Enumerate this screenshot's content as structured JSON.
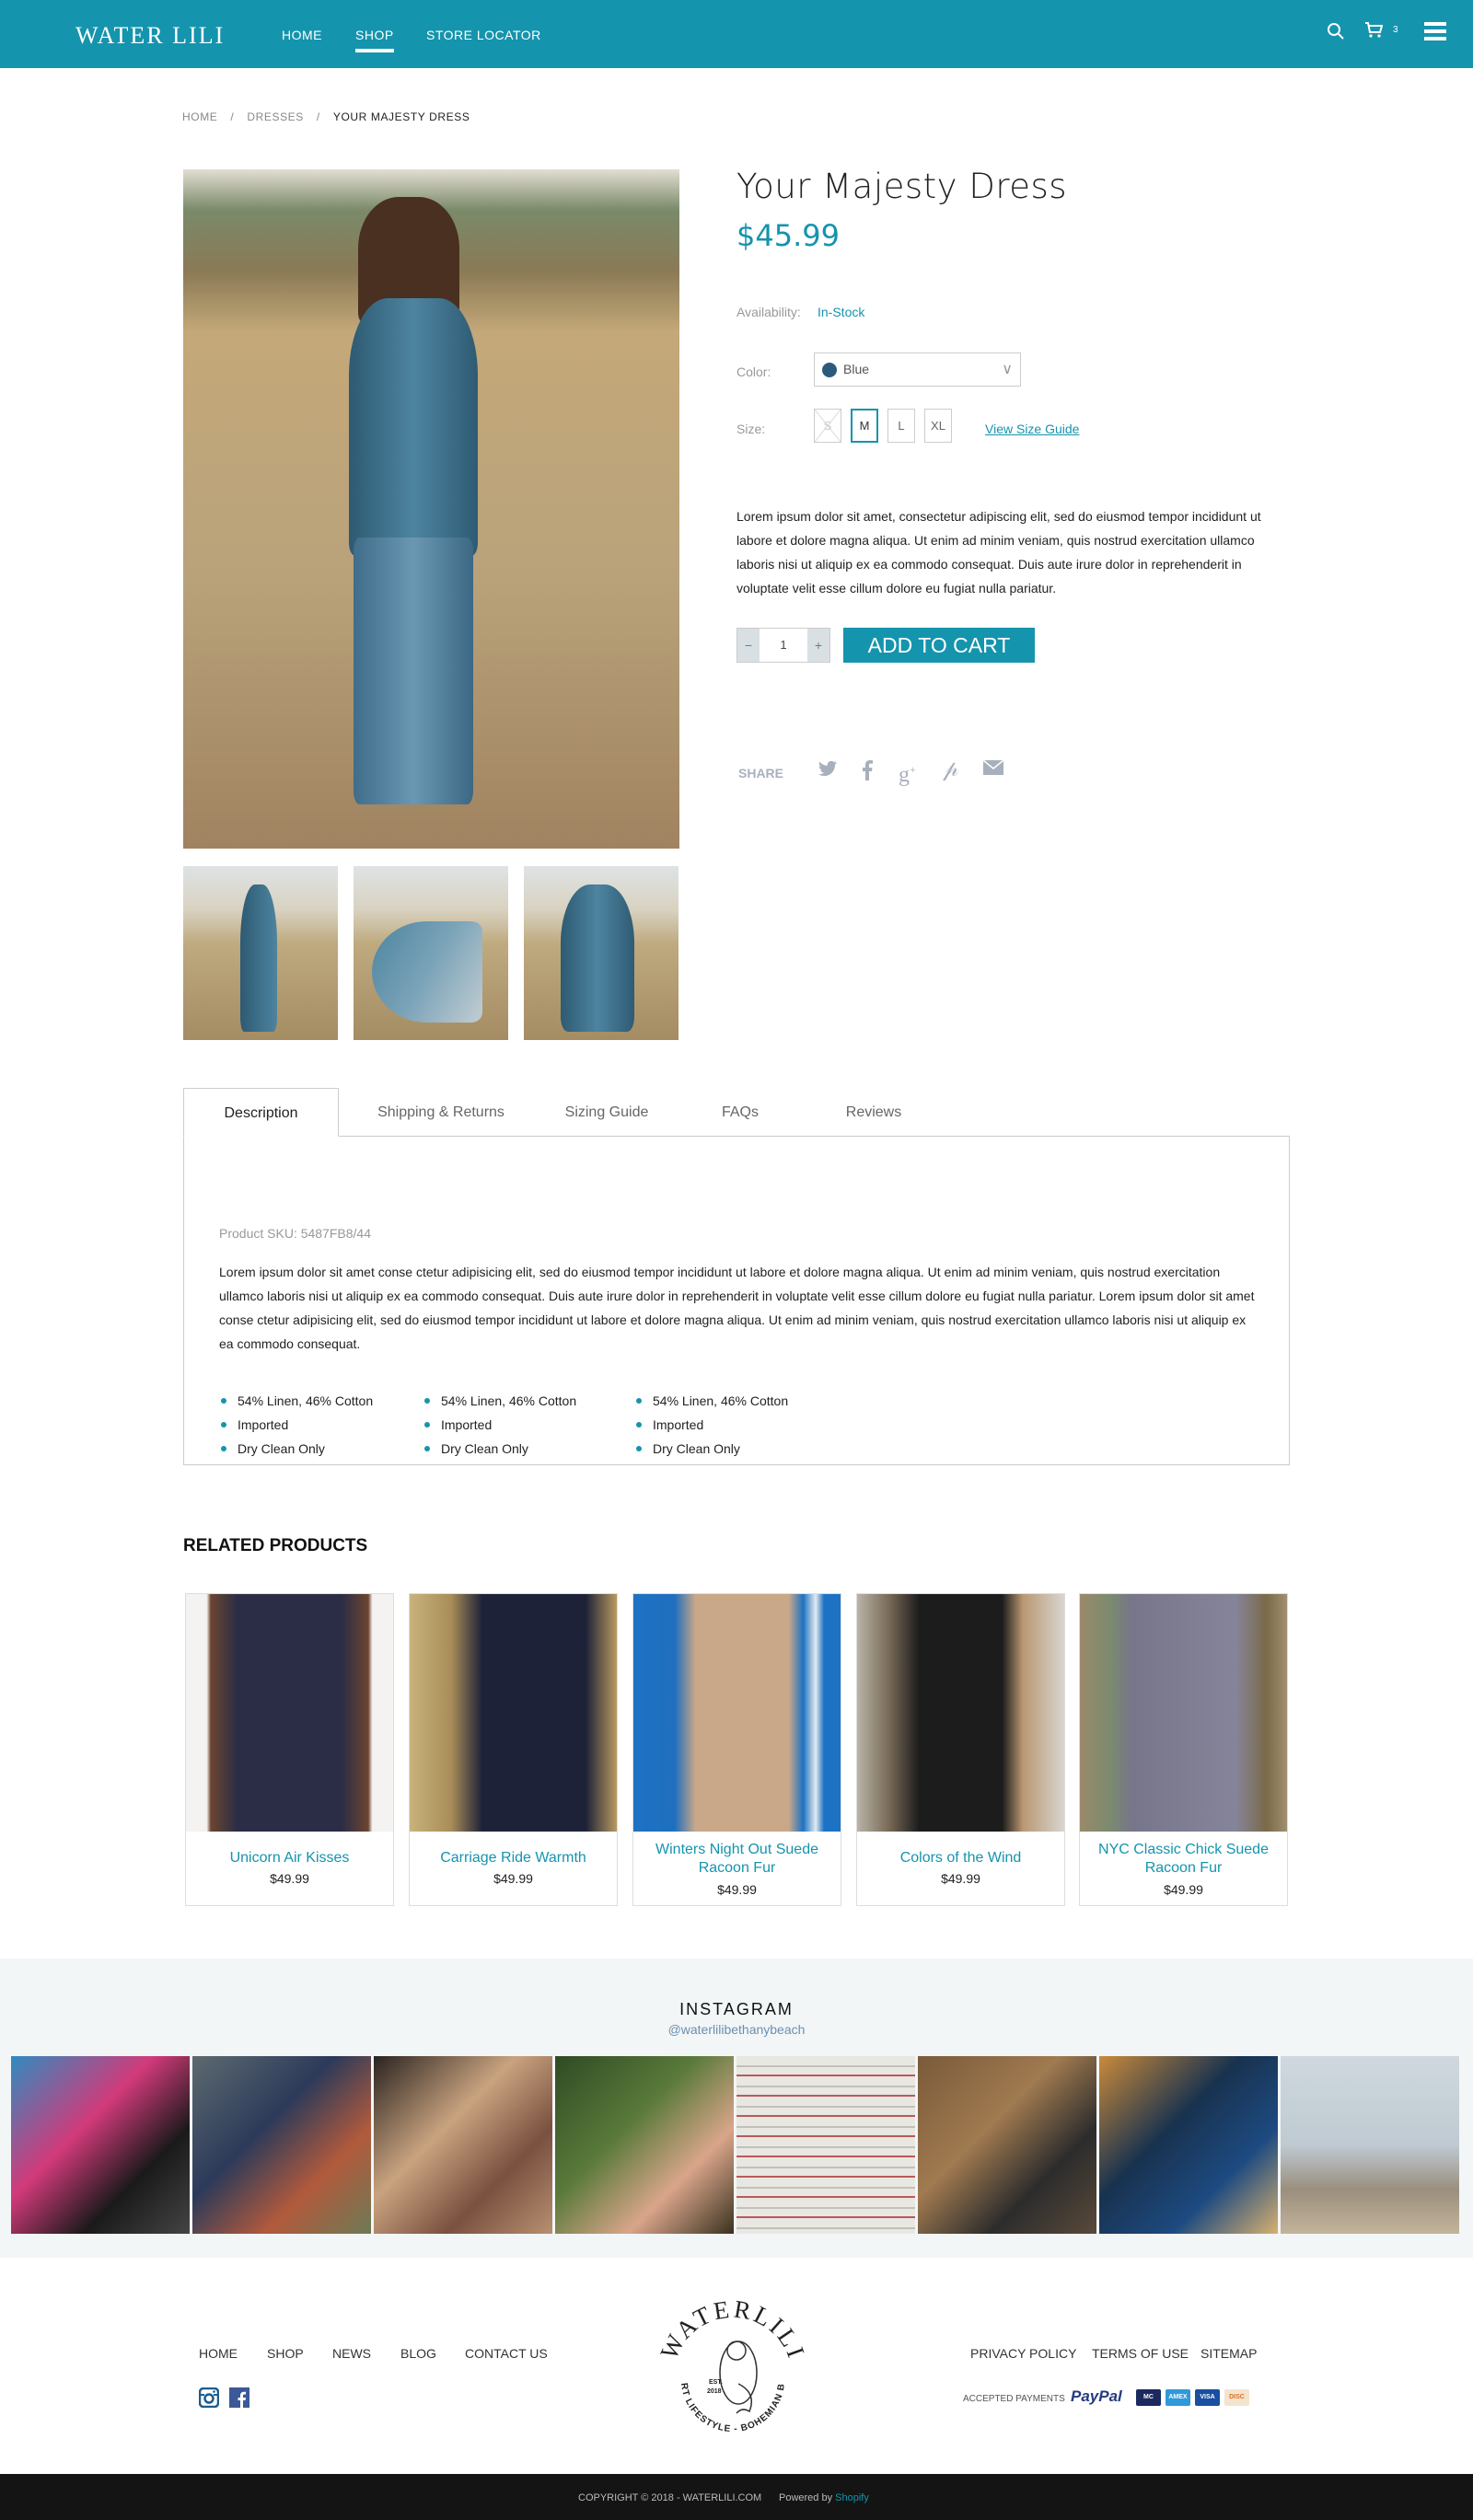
{
  "header": {
    "logo": "WATER LILI",
    "nav": [
      {
        "label": "HOME",
        "active": false
      },
      {
        "label": "SHOP",
        "active": true
      },
      {
        "label": "STORE LOCATOR",
        "active": false
      }
    ],
    "cart_count": "3",
    "icons": [
      "search-icon",
      "cart-icon",
      "menu-icon"
    ]
  },
  "breadcrumb": {
    "items": [
      "HOME",
      "DRESSES",
      "YOUR MAJESTY DRESS"
    ],
    "separator": "/"
  },
  "product": {
    "title": "Your Majesty Dress",
    "price": "$45.99",
    "availability_label": "Availability:",
    "availability_value": "In-Stock",
    "color_label": "Color:",
    "color_value": "Blue",
    "color_swatch": "#2b5b7c",
    "size_label": "Size:",
    "sizes": [
      {
        "label": "S",
        "state": "unavailable"
      },
      {
        "label": "M",
        "state": "selected"
      },
      {
        "label": "L",
        "state": "available"
      },
      {
        "label": "XL",
        "state": "available"
      }
    ],
    "size_guide_link": "View Size Guide",
    "description": "Lorem ipsum dolor sit amet, consectetur adipiscing elit, sed do eiusmod tempor incididunt ut labore et dolore magna aliqua. Ut enim ad minim veniam, quis nostrud exercitation ullamco laboris nisi ut aliquip ex ea commodo consequat. Duis aute irure dolor in reprehenderit in voluptate velit esse cillum dolore eu fugiat nulla pariatur.",
    "quantity": "1",
    "qty_minus": "−",
    "qty_plus": "+",
    "add_to_cart": "ADD TO CART",
    "share_label": "SHARE",
    "share_icons": [
      "twitter-icon",
      "facebook-icon",
      "google-plus-icon",
      "pinterest-icon",
      "email-icon"
    ]
  },
  "tabs": {
    "items": [
      "Description",
      "Shipping & Returns",
      "Sizing Guide",
      "FAQs",
      "Reviews"
    ],
    "active": "Description",
    "sku": "Product SKU: 5487FB8/44",
    "body": "Lorem ipsum dolor sit amet conse ctetur adipisicing elit, sed do eiusmod tempor incididunt ut labore et dolore magna aliqua. Ut enim ad minim veniam, quis nostrud exercitation ullamco laboris nisi ut aliquip ex ea commodo consequat. Duis aute irure dolor in reprehenderit in voluptate velit esse cillum dolore eu fugiat nulla pariatur. Lorem ipsum dolor sit amet conse ctetur adipisicing elit, sed do eiusmod tempor incididunt ut labore et dolore magna aliqua. Ut enim ad minim veniam, quis nostrud exercitation ullamco laboris nisi ut aliquip ex ea commodo consequat.",
    "bullet_columns": [
      [
        "54% Linen, 46% Cotton",
        "Imported",
        "Dry Clean Only"
      ],
      [
        "54% Linen, 46% Cotton",
        "Imported",
        "Dry Clean Only"
      ],
      [
        "54% Linen, 46% Cotton",
        "Imported",
        "Dry Clean Only"
      ]
    ]
  },
  "related": {
    "heading": "RELATED PRODUCTS",
    "products": [
      {
        "name": "Unicorn Air Kisses",
        "price": "$49.99"
      },
      {
        "name": "Carriage Ride Warmth",
        "price": "$49.99"
      },
      {
        "name": "Winters Night Out Suede Racoon Fur",
        "price": "$49.99"
      },
      {
        "name": "Colors of the Wind",
        "price": "$49.99"
      },
      {
        "name": "NYC Classic Chick Suede Racoon Fur",
        "price": "$49.99"
      }
    ]
  },
  "instagram": {
    "heading": "INSTAGRAM",
    "handle": "@waterlilibethanybeach",
    "photo_count": 8
  },
  "footer": {
    "links_left": [
      "HOME",
      "SHOP",
      "NEWS",
      "BLOG",
      "CONTACT US"
    ],
    "social_icons": [
      "instagram-icon",
      "facebook-icon"
    ],
    "logo": {
      "wordmark": "WATERLILI",
      "tagline": "RESORT LIFESTYLE - BOHEMIAN BEACH",
      "est": "EST.",
      "year": "2018"
    },
    "links_right": [
      "PRIVACY POLICY",
      "TERMS OF USE",
      "SITEMAP"
    ],
    "payments_label": "ACCEPTED PAYMENTS",
    "payments": [
      "PayPal",
      "MC",
      "AMEX",
      "VISA",
      "DISC"
    ],
    "copyright": "COPYRIGHT ©  2018 - WATERLILI.COM",
    "powered_prefix": "Powered by",
    "powered_link": "Shopify"
  },
  "colors": {
    "brand": "#1594ad",
    "footer_bg": "#141414",
    "instagram_bg": "#f3f6f7"
  }
}
